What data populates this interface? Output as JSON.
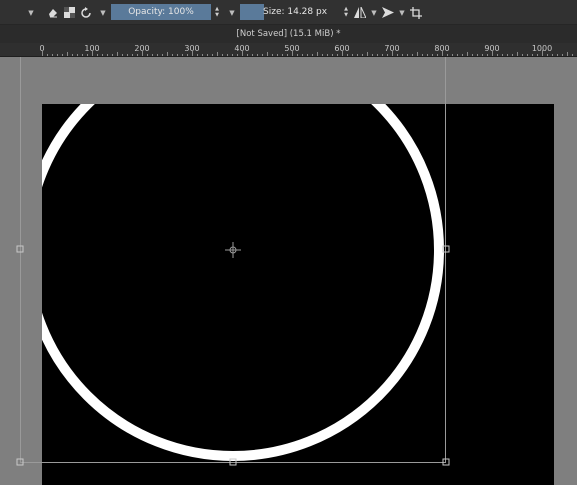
{
  "toolbar": {
    "opacity_label": "Opacity: 100%",
    "size_label": "Size: 14.28 px",
    "icons": [
      "chevron-down-icon",
      "eraser-icon",
      "alpha-lock-icon",
      "reset-icon",
      "chevron-down-icon",
      "chevron-down-icon",
      "mirror-icon",
      "chevron-down-icon",
      "wrap-icon",
      "chevron-down-icon",
      "crop-icon"
    ]
  },
  "document": {
    "title": "[Not Saved]  (15.1 MiB) *"
  },
  "ruler": {
    "labels": [
      "0",
      "100",
      "200",
      "300",
      "400",
      "500",
      "600",
      "700",
      "800",
      "900",
      "1000"
    ]
  },
  "colors": {
    "toolbar_bg": "#313131",
    "accent": "#5a7a9a",
    "canvas_bg": "#000000",
    "stroke": "#ffffff",
    "workspace": "#7f7f7f"
  }
}
